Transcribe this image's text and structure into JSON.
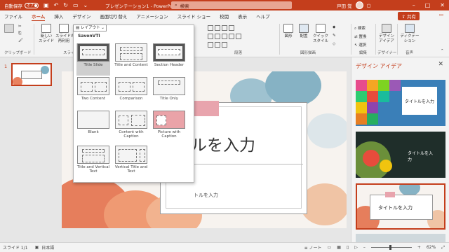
{
  "titlebar": {
    "autosave_label": "自動保存",
    "autosave_state": "オフ",
    "doc_title": "プレゼンテーション1 - PowerPo...",
    "search_label": "検索",
    "user_name": "戸田 覚"
  },
  "tabs": [
    "ファイル",
    "ホーム",
    "挿入",
    "デザイン",
    "画面切り替え",
    "アニメーション",
    "スライド ショー",
    "校閲",
    "表示",
    "ヘルプ"
  ],
  "share_label": "共有",
  "ribbon": {
    "paste_label": "貼り付け",
    "new_slide_label": "新しい\nスライド",
    "reuse_label": "スライドの\n再利用",
    "layout_label": "レイアウト",
    "clipboard_group": "クリップボード",
    "slides_group": "スライ",
    "paragraph_group": "段落",
    "drawing_group": "図形描画",
    "shape_label": "図形",
    "arrange_label": "配置",
    "quick_style_label": "クイック\nスタイル",
    "find_label": "検索",
    "replace_label": "置換",
    "select_label": "選択",
    "editing_group": "編集",
    "designer_label": "デザイン\nアイデア",
    "designer_group": "デザイナー",
    "dictate_label": "ディクテー\nション",
    "voice_group": "音声"
  },
  "layout_menu": {
    "button_label": "レイアウト",
    "header": "SavonVTI",
    "items": [
      {
        "label": "Title Slide"
      },
      {
        "label": "Title and Content"
      },
      {
        "label": "Section Header"
      },
      {
        "label": "Two Content"
      },
      {
        "label": "Comparison"
      },
      {
        "label": "Title Only"
      },
      {
        "label": "Blank"
      },
      {
        "label": "Content with Caption"
      },
      {
        "label": "Picture with Caption"
      },
      {
        "label": "Title and Vertical Text"
      },
      {
        "label": "Vertical Title and Text"
      }
    ]
  },
  "thumbnails": {
    "number": "1"
  },
  "slide": {
    "title_text": "ルを入力",
    "subtitle_text": "トルを入力"
  },
  "design_pane": {
    "title": "デザイン アイデア",
    "card1_text": "タイトルを入力",
    "card2_text": "タイトルを入\n力",
    "card3_text": "タイトルを入力"
  },
  "status": {
    "slide_info": "スライド 1/1",
    "language": "日本語",
    "notes": "ノート",
    "zoom": "62%"
  },
  "colors": {
    "accent": "#c43e1c",
    "ribbon_bg": "#f3f3f3"
  }
}
